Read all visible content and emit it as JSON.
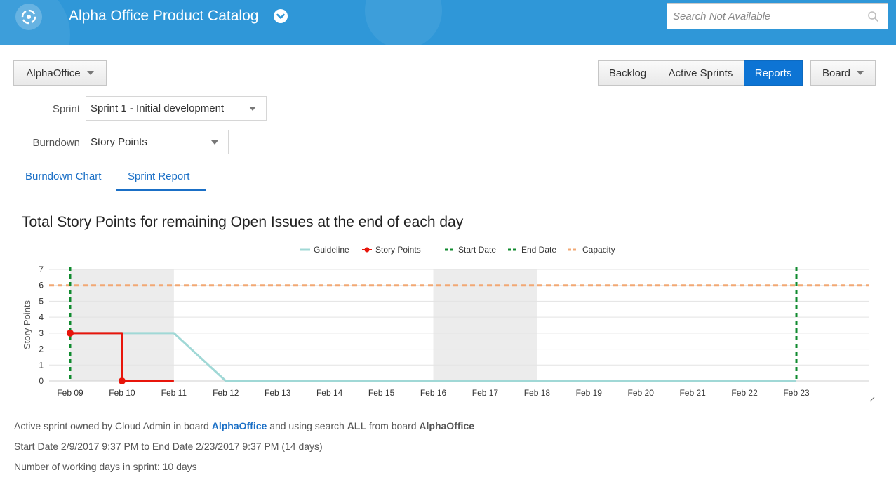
{
  "header": {
    "app_title": "Alpha Office Product Catalog",
    "search_placeholder": "Search Not Available"
  },
  "toolbar": {
    "project_label": "AlphaOffice",
    "views": [
      {
        "label": "Backlog",
        "active": false
      },
      {
        "label": "Active Sprints",
        "active": false
      },
      {
        "label": "Reports",
        "active": true
      }
    ],
    "board_label": "Board"
  },
  "filters": {
    "sprint_label": "Sprint",
    "sprint_value": "Sprint 1 - Initial development",
    "burndown_label": "Burndown",
    "burndown_value": "Story Points"
  },
  "tabs": [
    {
      "label": "Burndown Chart",
      "active": false
    },
    {
      "label": "Sprint Report",
      "active": true
    }
  ],
  "chart_data": {
    "type": "line",
    "title": "Total Story Points for remaining Open Issues at the end of each day",
    "ylabel": "Story Points",
    "xlabel": "",
    "ylim": [
      0,
      7
    ],
    "yticks": [
      "0",
      "1",
      "2",
      "3",
      "4",
      "5",
      "6",
      "7"
    ],
    "categories": [
      "Feb 09",
      "Feb 10",
      "Feb 11",
      "Feb 12",
      "Feb 13",
      "Feb 14",
      "Feb 15",
      "Feb 16",
      "Feb 17",
      "Feb 18",
      "Feb 19",
      "Feb 20",
      "Feb 21",
      "Feb 22",
      "Feb 23"
    ],
    "non_working_days": [
      [
        "Feb 09",
        "Feb 11"
      ],
      [
        "Feb 16",
        "Feb 18"
      ]
    ],
    "legend": [
      "Guideline",
      "Story Points",
      "Start Date",
      "End Date",
      "Capacity"
    ],
    "legend_position": "top-center",
    "grid": true,
    "series": [
      {
        "name": "Guideline",
        "color": "#a0d8d6",
        "points": [
          [
            "Feb 09",
            3
          ],
          [
            "Feb 11",
            3
          ],
          [
            "Feb 12",
            0
          ],
          [
            "Feb 23",
            0
          ]
        ]
      },
      {
        "name": "Story Points",
        "color": "#e8150b",
        "step": true,
        "points": [
          [
            "Feb 09",
            3
          ],
          [
            "Feb 10",
            0
          ],
          [
            "Feb 11",
            0
          ]
        ]
      }
    ],
    "start_date": "Feb 09",
    "end_date": "Feb 23",
    "capacity": 6,
    "colors": {
      "start_date": "#0f8a2e",
      "end_date": "#0f8a2e",
      "capacity": "#f2a874"
    }
  },
  "info": {
    "line1_prefix": "Active sprint owned by Cloud Admin in board",
    "line1_board": "AlphaOffice",
    "line1_mid": "and using search",
    "line1_search": "ALL",
    "line1_from": "from board",
    "line1_board2": "AlphaOffice",
    "line2": "Start Date 2/9/2017 9:37 PM to End Date 2/23/2017 9:37 PM (14 days)",
    "line3": "Number of working days in sprint: 10 days"
  },
  "colors": {
    "header_bg": "#2f97d8",
    "accent": "#0d74d4",
    "link": "#1a6fc6"
  }
}
